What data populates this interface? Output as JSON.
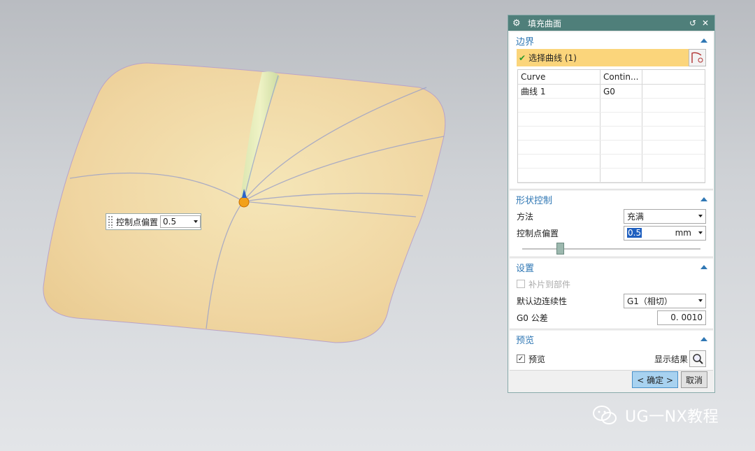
{
  "viewport": {
    "floating_input": {
      "label": "控制点偏置",
      "value": "0.5"
    }
  },
  "dialog": {
    "title": "填充曲面",
    "boundary": {
      "header": "边界",
      "select_label": "选择曲线 (1)",
      "columns": [
        "Curve",
        "Contin..."
      ],
      "rows": [
        [
          "曲线 1",
          "G0"
        ]
      ]
    },
    "shape_control": {
      "header": "形状控制",
      "method_label": "方法",
      "method_value": "充满",
      "offset_label": "控制点偏置",
      "offset_value": "0.5",
      "offset_unit": "mm",
      "slider_level": 0.2
    },
    "settings": {
      "header": "设置",
      "patch_label": "补片到部件",
      "continuity_label": "默认边连续性",
      "continuity_value": "G1（相切）",
      "tolerance_label": "G0 公差",
      "tolerance_value": "0. 0010"
    },
    "preview": {
      "header": "预览",
      "preview_label": "预览",
      "show_result_label": "显示结果"
    },
    "buttons": {
      "ok": "< 确定 >",
      "cancel": "取消"
    }
  },
  "watermark": {
    "text": "UG一NX教程"
  },
  "colors": {
    "title_bar": "#4f7f7a",
    "section_header": "#2f77b4",
    "selection_row": "#fbd57b",
    "surface": "#f1d9a8"
  }
}
